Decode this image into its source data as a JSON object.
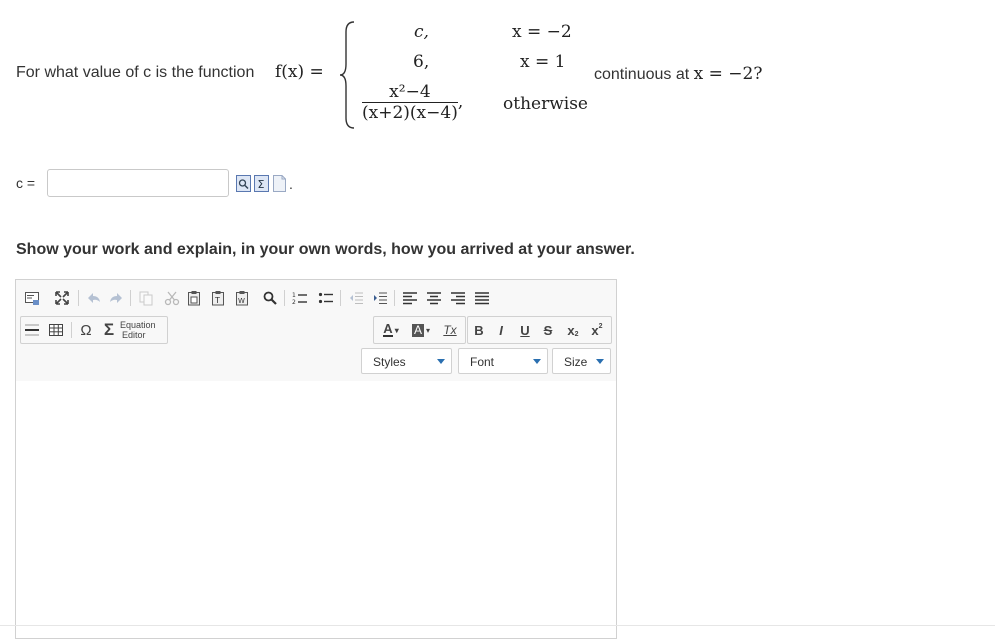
{
  "question": {
    "prefix": "For what value of c is the function",
    "func": "f(x) =",
    "cases": [
      {
        "value": "c,",
        "condition": "x = −2"
      },
      {
        "value": "6,",
        "condition": "x = 1"
      },
      {
        "numerator": "x²−4",
        "denominator": "(x+2)(x−4)",
        "value_suffix": ",",
        "condition": "otherwise"
      }
    ],
    "suffix_text": "continuous at",
    "suffix_math": "x = −2?"
  },
  "answer": {
    "label": "c =",
    "value": "",
    "period": "."
  },
  "work_prompt": "Show your work and explain, in your own words, how you arrived at your answer.",
  "editor": {
    "dropdowns": {
      "styles": "Styles",
      "font": "Font",
      "size": "Size"
    },
    "equation_editor": [
      "Equation",
      "Editor"
    ],
    "text_color": "A",
    "bg_color": "A",
    "remove_format": "Tx",
    "bold": "B",
    "italic": "I",
    "underline": "U",
    "strike": "S",
    "omega": "Ω",
    "sigma": "Σ",
    "subscript": "x",
    "superscript": "x"
  },
  "colors": {
    "accent": "#2a6fb0",
    "text": "#333333",
    "border": "#d1d1d1",
    "toolbar_bg": "#f8f8f8"
  }
}
